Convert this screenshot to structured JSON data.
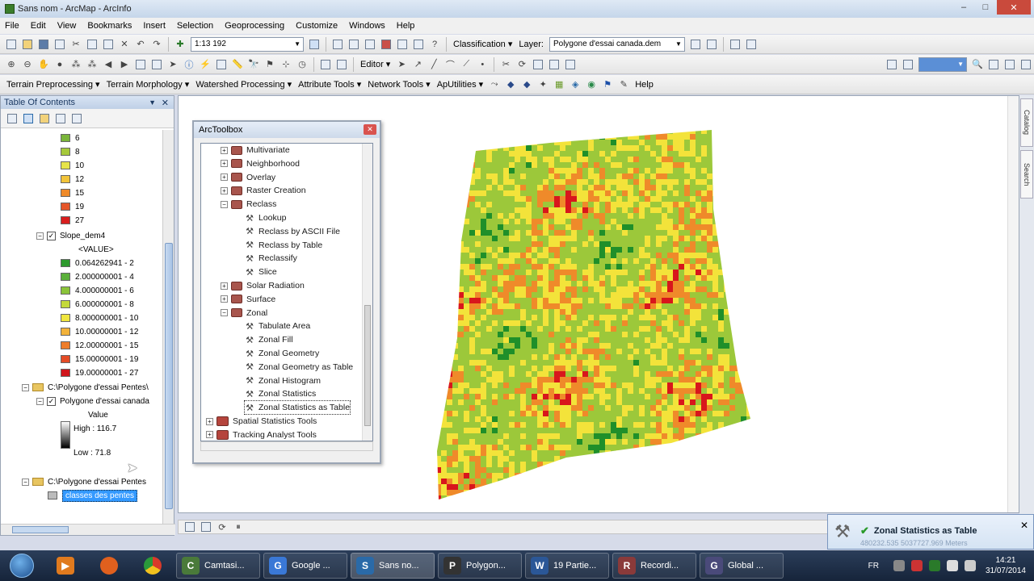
{
  "window": {
    "title": "Sans nom - ArcMap - ArcInfo",
    "min": "–",
    "max": "□",
    "close": "✕"
  },
  "menu": [
    "File",
    "Edit",
    "View",
    "Bookmarks",
    "Insert",
    "Selection",
    "Geoprocessing",
    "Customize",
    "Windows",
    "Help"
  ],
  "toolbar1": {
    "scale": "1:13 192",
    "classification_label": "Classification ▾",
    "layer_label": "Layer:",
    "layer_value": "Polygone d'essai canada.dem"
  },
  "toolbar2": {
    "editor_label": "Editor ▾"
  },
  "toolbar3": {
    "items": [
      "Terrain Preprocessing ▾",
      "Terrain Morphology ▾",
      "Watershed Processing ▾",
      "Attribute Tools ▾",
      "Network Tools ▾",
      "ApUtilities ▾"
    ],
    "help": "Help"
  },
  "toc": {
    "title": "Table Of Contents",
    "top_classes": [
      {
        "label": "6",
        "color": "#7ab53a"
      },
      {
        "label": "8",
        "color": "#a6c93a"
      },
      {
        "label": "10",
        "color": "#e6e44a"
      },
      {
        "label": "12",
        "color": "#f2c43a"
      },
      {
        "label": "15",
        "color": "#ef8a2a"
      },
      {
        "label": "19",
        "color": "#e5562a"
      },
      {
        "label": "27",
        "color": "#d81e1e"
      }
    ],
    "slope_layer": "Slope_dem4",
    "slope_field": "<VALUE>",
    "slope_classes": [
      {
        "label": "0.064262941 - 2",
        "color": "#2e9a2e"
      },
      {
        "label": "2.000000001 - 4",
        "color": "#5bb03a"
      },
      {
        "label": "4.000000001 - 6",
        "color": "#8bc43a"
      },
      {
        "label": "6.000000001 - 8",
        "color": "#c4d93a"
      },
      {
        "label": "8.000000001 - 10",
        "color": "#f0e63e"
      },
      {
        "label": "10.00000001 - 12",
        "color": "#f2b23a"
      },
      {
        "label": "12.00000001 - 15",
        "color": "#ee7d2a"
      },
      {
        "label": "15.00000001 - 19",
        "color": "#e44c26"
      },
      {
        "label": "19.00000001 - 27",
        "color": "#d0151c"
      }
    ],
    "group1": "C:\\Polygone d'essai Pentes\\",
    "dem_layer": "Polygone d'essai canada",
    "dem_field": "Value",
    "dem_high": "High : 116.7",
    "dem_low": "Low : 71.8",
    "group2": "C:\\Polygone d'essai Pentes",
    "selected_layer": "classes des pentes"
  },
  "toolbox": {
    "title": "ArcToolbox",
    "items": [
      {
        "label": "Multivariate",
        "kind": "toolset",
        "level": 1,
        "exp": "+"
      },
      {
        "label": "Neighborhood",
        "kind": "toolset",
        "level": 1,
        "exp": "+"
      },
      {
        "label": "Overlay",
        "kind": "toolset",
        "level": 1,
        "exp": "+"
      },
      {
        "label": "Raster Creation",
        "kind": "toolset",
        "level": 1,
        "exp": "+"
      },
      {
        "label": "Reclass",
        "kind": "toolset",
        "level": 1,
        "exp": "-"
      },
      {
        "label": "Lookup",
        "kind": "tool",
        "level": 2
      },
      {
        "label": "Reclass by ASCII File",
        "kind": "tool",
        "level": 2
      },
      {
        "label": "Reclass by Table",
        "kind": "tool",
        "level": 2
      },
      {
        "label": "Reclassify",
        "kind": "tool",
        "level": 2
      },
      {
        "label": "Slice",
        "kind": "tool",
        "level": 2
      },
      {
        "label": "Solar Radiation",
        "kind": "toolset",
        "level": 1,
        "exp": "+"
      },
      {
        "label": "Surface",
        "kind": "toolset",
        "level": 1,
        "exp": "+"
      },
      {
        "label": "Zonal",
        "kind": "toolset",
        "level": 1,
        "exp": "-"
      },
      {
        "label": "Tabulate Area",
        "kind": "tool",
        "level": 2
      },
      {
        "label": "Zonal Fill",
        "kind": "tool",
        "level": 2
      },
      {
        "label": "Zonal Geometry",
        "kind": "tool",
        "level": 2
      },
      {
        "label": "Zonal Geometry as Table",
        "kind": "tool",
        "level": 2
      },
      {
        "label": "Zonal Histogram",
        "kind": "tool",
        "level": 2
      },
      {
        "label": "Zonal Statistics",
        "kind": "tool",
        "level": 2
      },
      {
        "label": "Zonal Statistics as Table",
        "kind": "tool",
        "level": 2
      },
      {
        "label": "Spatial Statistics Tools",
        "kind": "box",
        "level": 0,
        "exp": "+"
      },
      {
        "label": "Tracking Analyst Tools",
        "kind": "box",
        "level": 0,
        "exp": "+"
      }
    ]
  },
  "right_tabs": [
    "Catalog",
    "Search"
  ],
  "notification": {
    "message": "Zonal Statistics as Table",
    "coords": "480232.535  5037727.969 Meters",
    "close": "✕"
  },
  "taskbar": {
    "tasks": [
      {
        "label": "Camtasi...",
        "color": "#4a7a3a",
        "glyph": "C"
      },
      {
        "label": "Google ...",
        "color": "#3a78d6",
        "glyph": "G"
      },
      {
        "label": "Sans no...",
        "color": "#2a6aa8",
        "glyph": "S",
        "active": true
      },
      {
        "label": "Polygon...",
        "color": "#333333",
        "glyph": "P"
      },
      {
        "label": "19 Partie...",
        "color": "#2b5797",
        "glyph": "W"
      },
      {
        "label": "Recordi...",
        "color": "#8a3a3a",
        "glyph": "R"
      },
      {
        "label": "Global ...",
        "color": "#4a4a7a",
        "glyph": "G"
      }
    ],
    "lang": "FR",
    "time": "14:21",
    "date": "31/07/2014"
  },
  "colors": {
    "slope_low": "#1f8f2a",
    "slope_mid": "#9cc83a",
    "slope_yellow": "#f3e33a",
    "slope_orange": "#ef8a2a",
    "slope_high": "#d8161c"
  }
}
